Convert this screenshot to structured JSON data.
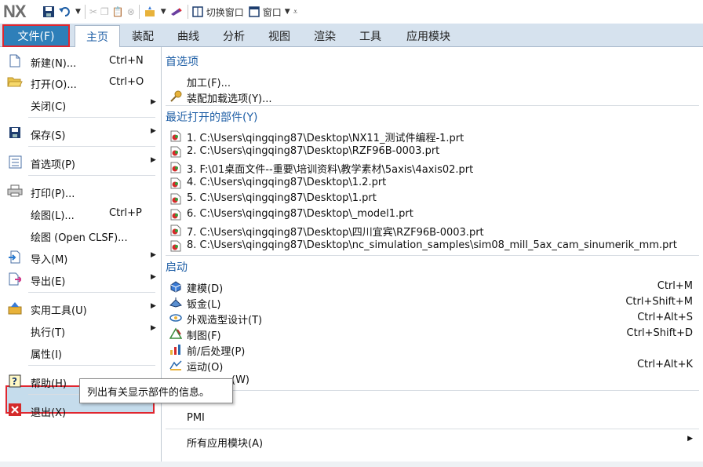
{
  "app": {
    "logo": "NX"
  },
  "qat": {
    "switch_window": "切换窗口",
    "window": "窗口"
  },
  "ribbon": {
    "tabs": [
      {
        "label": "文件(F)"
      },
      {
        "label": "主页"
      },
      {
        "label": "装配"
      },
      {
        "label": "曲线"
      },
      {
        "label": "分析"
      },
      {
        "label": "视图"
      },
      {
        "label": "渲染"
      },
      {
        "label": "工具"
      },
      {
        "label": "应用模块"
      }
    ]
  },
  "file_menu": {
    "items": [
      {
        "label": "新建(N)...",
        "shortcut": "Ctrl+N"
      },
      {
        "label": "打开(O)...",
        "shortcut": "Ctrl+O"
      },
      {
        "label": "关闭(C)",
        "shortcut": ""
      },
      {
        "label": "保存(S)",
        "shortcut": ""
      },
      {
        "label": "首选项(P)",
        "shortcut": ""
      },
      {
        "label": "打印(P)...",
        "shortcut": ""
      },
      {
        "label": "绘图(L)...",
        "shortcut": "Ctrl+P"
      },
      {
        "label": "绘图 (Open CLSF)...",
        "shortcut": ""
      },
      {
        "label": "导入(M)",
        "shortcut": ""
      },
      {
        "label": "导出(E)",
        "shortcut": ""
      },
      {
        "label": "实用工具(U)",
        "shortcut": ""
      },
      {
        "label": "执行(T)",
        "shortcut": ""
      },
      {
        "label": "属性(I)",
        "shortcut": ""
      },
      {
        "label": "帮助(H)",
        "shortcut": ""
      },
      {
        "label": "退出(X)",
        "shortcut": ""
      }
    ]
  },
  "tooltip": {
    "text": "列出有关显示部件的信息。"
  },
  "right_panel": {
    "prefs_header": "首选项",
    "prefs": [
      {
        "label": "加工(F)..."
      },
      {
        "label": "装配加载选项(Y)..."
      }
    ],
    "recent_header": "最近打开的部件(Y)",
    "recent": [
      {
        "label": "1. C:\\Users\\qingqing87\\Desktop\\NX11_测试件编程-1.prt"
      },
      {
        "label": "2. C:\\Users\\qingqing87\\Desktop\\RZF96B-0003.prt"
      },
      {
        "label": "3. F:\\01桌面文件--重要\\培训资料\\教学素材\\5axis\\4axis02.prt"
      },
      {
        "label": "4. C:\\Users\\qingqing87\\Desktop\\1.2.prt"
      },
      {
        "label": "5. C:\\Users\\qingqing87\\Desktop\\1.prt"
      },
      {
        "label": "6. C:\\Users\\qingqing87\\Desktop\\_model1.prt"
      },
      {
        "label": "7. C:\\Users\\qingqing87\\Desktop\\四川宜宾\\RZF96B-0003.prt"
      },
      {
        "label": "8. C:\\Users\\qingqing87\\Desktop\\nc_simulation_samples\\sim08_mill_5ax_cam_sinumerik_mm.prt"
      }
    ],
    "launch_header": "启动",
    "launch": [
      {
        "label": "建模(D)",
        "shortcut": "Ctrl+M"
      },
      {
        "label": "钣金(L)",
        "shortcut": "Ctrl+Shift+M"
      },
      {
        "label": "外观造型设计(T)",
        "shortcut": "Ctrl+Alt+S"
      },
      {
        "label": "制图(F)",
        "shortcut": "Ctrl+Shift+D"
      },
      {
        "label": "前/后处理(P)",
        "shortcut": ""
      },
      {
        "label": "运动(O)",
        "shortcut": "Ctrl+Alt+K"
      },
      {
        "label": "(W)",
        "shortcut": ""
      },
      {
        "label": "PMI",
        "shortcut": ""
      }
    ],
    "all_apps": "所有应用模块(A)"
  }
}
